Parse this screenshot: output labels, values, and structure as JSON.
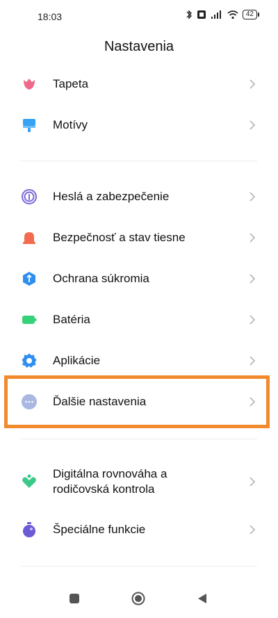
{
  "status_bar": {
    "time": "18:03",
    "battery": "42",
    "icons": [
      "bluetooth-icon",
      "sim-icon",
      "signal-icon",
      "wifi-icon",
      "battery-icon"
    ]
  },
  "page": {
    "title": "Nastavenia"
  },
  "items": [
    {
      "label": "Tapeta",
      "icon": "wallpaper-icon",
      "color": "#ef6a8a"
    },
    {
      "label": "Motívy",
      "icon": "themes-icon",
      "color": "#36a3f4"
    },
    {
      "label": "Heslá a zabezpečenie",
      "icon": "fingerprint-icon",
      "color": "#7a66d8"
    },
    {
      "label": "Bezpečnosť a stav tiesne",
      "icon": "emergency-icon",
      "color": "#f26b4e"
    },
    {
      "label": "Ochrana súkromia",
      "icon": "privacy-icon",
      "color": "#2f8ef0"
    },
    {
      "label": "Batéria",
      "icon": "battery-icon",
      "color": "#35d27a"
    },
    {
      "label": "Aplikácie",
      "icon": "apps-gear-icon",
      "color": "#2f8ef0"
    },
    {
      "label": "Ďalšie nastavenia",
      "icon": "more-settings-icon",
      "color": "#a9b8e2"
    },
    {
      "label_line1": "Digitálna rovnováha a",
      "label_line2": "rodičovská kontrola",
      "icon": "digital-wellbeing-icon",
      "color": "#3bc98a"
    },
    {
      "label": "Špeciálne funkcie",
      "icon": "special-features-icon",
      "color": "#6b5bd6"
    }
  ],
  "colors": {
    "highlight": "#f18a2c",
    "chevron": "#b5b5b5"
  }
}
